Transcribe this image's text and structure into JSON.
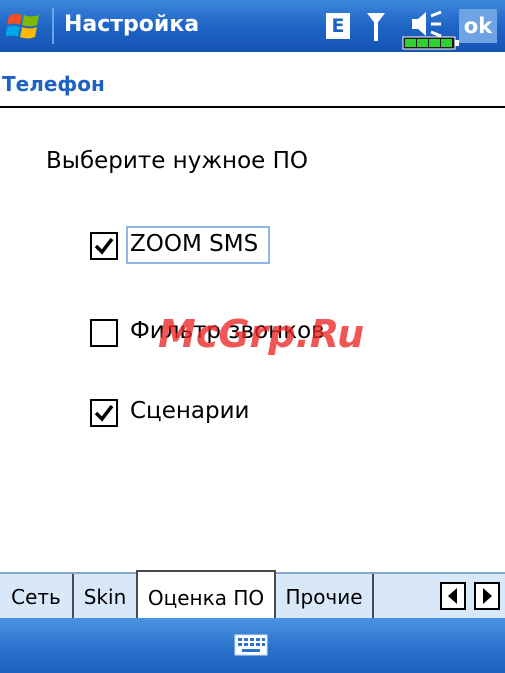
{
  "titlebar": {
    "title": "Настройка",
    "network_indicator": "E",
    "ok_label": "ok",
    "icons": [
      "windows-start-icon",
      "antenna-icon",
      "speaker-icon",
      "battery-icon"
    ]
  },
  "page": {
    "title": "Телефон",
    "prompt": "Выберите нужное ПО"
  },
  "options": [
    {
      "label": "ZOOM SMS",
      "checked": true,
      "focused": true
    },
    {
      "label": "Фильтр звонков",
      "checked": false,
      "focused": false
    },
    {
      "label": "Сценарии",
      "checked": true,
      "focused": false
    }
  ],
  "watermark": "McGrp.Ru",
  "tabs": [
    {
      "label": "Сеть",
      "active": false
    },
    {
      "label": "Skin",
      "active": false
    },
    {
      "label": "Оценка ПО",
      "active": true
    },
    {
      "label": "Прочие",
      "active": false
    }
  ],
  "bottombar": {
    "icon": "keyboard-icon"
  },
  "colors": {
    "accent": "#1d62c4",
    "titlebar": "#2a72cc",
    "tabbar_bg": "#d8e8f8",
    "watermark": "#ec2626"
  }
}
